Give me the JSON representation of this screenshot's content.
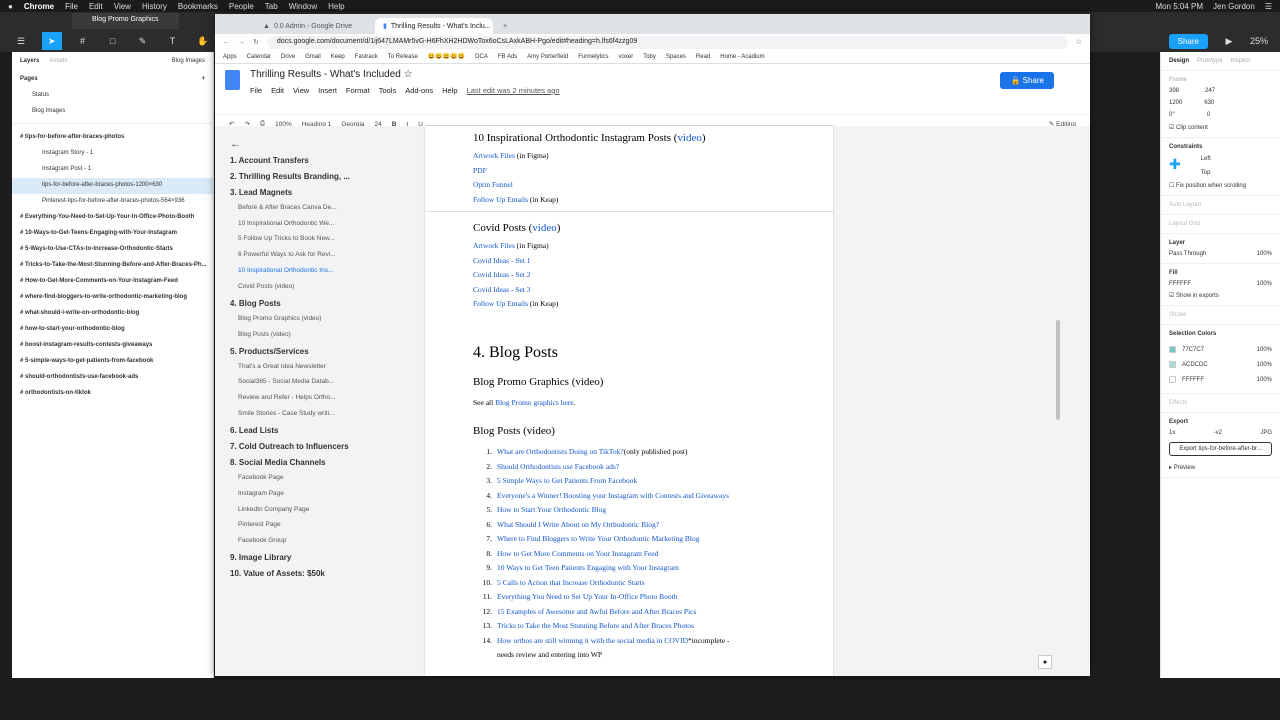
{
  "mac": {
    "app": "Chrome",
    "menus": [
      "File",
      "Edit",
      "View",
      "History",
      "Bookmarks",
      "People",
      "Tab",
      "Window",
      "Help"
    ],
    "clock": "Mon 5:04 PM",
    "user": "Jen Gordon"
  },
  "figma": {
    "file_tab": "Blog Promo Graphics",
    "share": "Share",
    "zoom": "25%",
    "layers_tab": "Layers",
    "assets_tab": "Assets",
    "page_selector": "Blog Images",
    "pages_label": "Pages",
    "pages": [
      "Status",
      "Blog Images"
    ],
    "layers": [
      "tips-for-before-after-braces-photos",
      "Instagram Story - 1",
      "Instagram Post - 1",
      "tips-for-before-after-braces-photos-1200×630",
      "Pinterest-tips-for-before-after-braces-photos-564×936",
      "Everything-You-Need-to-Set-Up-Your-In-Office-Photo-Booth",
      "10-Ways-to-Get-Teens-Engaging-with-Your-Instagram",
      "5-Ways-to-Use-CTAs-to-Increase-Orthodontic-Starts",
      "Tricks-to-Take-the-Most-Stunning-Before-and-After-Braces-Ph...",
      "How-to-Get-More-Comments-on-Your-Instagram-Feed",
      "where-find-bloggers-to-write-orthodontic-marketing-blog",
      "what-should-i-write-on-orthodontic-blog",
      "how-to-start-your-orthodontic-blog",
      "boost-instagram-results-contests-giveaways",
      "5-simple-ways-to-get-patients-from-facebook",
      "should-orthodontists-use-facebook-ads",
      "orthodontists-on-tiktok"
    ],
    "right": {
      "tabs": [
        "Design",
        "Prototype",
        "Inspect"
      ],
      "frame": "Frame",
      "x": "398",
      "y": "247",
      "w": "1200",
      "h": "630",
      "rot": "0°",
      "radius": "0",
      "clip": "Clip content",
      "constraints": "Constraints",
      "h_con": "Left",
      "v_con": "Top",
      "fix": "Fix position when scrolling",
      "auto_layout": "Auto Layout",
      "layout_grid": "Layout Grid",
      "layer": "Layer",
      "blend": "Pass Through",
      "opacity": "100%",
      "fill": "Fill",
      "fill_hex": "FFFFFF",
      "fill_op": "100%",
      "show_exports": "Show in exports",
      "stroke": "Stroke",
      "sel_colors": "Selection Colors",
      "colors": [
        {
          "hex": "77C7C7",
          "op": "100%",
          "sw": "#77c7c7"
        },
        {
          "hex": "ACDCDC",
          "op": "100%",
          "sw": "#acdcdc"
        },
        {
          "hex": "FFFFFF",
          "op": "100%",
          "sw": "#ffffff"
        }
      ],
      "effects": "Effects",
      "export": "Export",
      "scale": "1x",
      "suffix": "-v2",
      "fmt": "JPG",
      "export_btn": "Export tips-for-before-after-br...",
      "preview": "Preview"
    }
  },
  "chrome": {
    "tabs": [
      "0.0 Admin - Google Drive",
      "Thrilling Results - What's Inclu..."
    ],
    "url": "docs.google.com/document/d/1ij647LMAMr5vG-H6FhXH2HDWoTox6oCsLAxkABH-Pgo/edit#heading=h.lfs6f4zzg09",
    "bookmarks": [
      "Apps",
      "Calendar",
      "Drive",
      "Gmail",
      "Keep",
      "Fastrack",
      "To Release",
      "😀😀😀😀😀",
      "DCA",
      "FB Ads",
      "Amy Porterfield",
      "Funnelytics",
      "voxer",
      "Toby",
      "Spaces",
      "Read",
      "Home - Acadium"
    ]
  },
  "docs": {
    "title": "Thrilling Results - What's Included",
    "menus": [
      "File",
      "Edit",
      "View",
      "Insert",
      "Format",
      "Tools",
      "Add-ons",
      "Help"
    ],
    "last_edit": "Last edit was 2 minutes ago",
    "share": "Share",
    "toolbar": {
      "zoom": "100%",
      "style": "Heading 1",
      "font": "Georgia",
      "size": "24",
      "mode": "Editing"
    }
  },
  "outline": [
    {
      "t": "1. Account Transfers",
      "h": true
    },
    {
      "t": "2. Thrilling Results Branding, ...",
      "h": true
    },
    {
      "t": "3. Lead Magnets",
      "h": true
    },
    {
      "t": "Before & After Braces Canva De..."
    },
    {
      "t": "10 Inspirational Orthodontic We..."
    },
    {
      "t": "5 Follow Up Tricks to Book New..."
    },
    {
      "t": "6 Powerful Ways to Ask for Revi..."
    },
    {
      "t": "10 Inspirational Orthodontic Ins...",
      "cur": true
    },
    {
      "t": "Covid Posts (video)"
    },
    {
      "t": "4. Blog Posts",
      "h": true
    },
    {
      "t": "Blog Promo Graphics (video)"
    },
    {
      "t": "Blog Posts (video)"
    },
    {
      "t": "5. Products/Services",
      "h": true
    },
    {
      "t": "That's a Great Idea Newsletter"
    },
    {
      "t": "Social365 - Social Media Datab..."
    },
    {
      "t": "Review and Refer - Helps Ortho..."
    },
    {
      "t": "Smile Stories - Case Study writi..."
    },
    {
      "t": "6. Lead Lists",
      "h": true
    },
    {
      "t": "7. Cold Outreach to Influencers",
      "h": true
    },
    {
      "t": "8. Social Media Channels",
      "h": true
    },
    {
      "t": "Facebook Page"
    },
    {
      "t": "Instagram Page"
    },
    {
      "t": "LinkedIn Company Page"
    },
    {
      "t": "Pinterest Page"
    },
    {
      "t": "Facebook Group"
    },
    {
      "t": "9. Image Library",
      "h": true
    },
    {
      "t": "10. Value of Assets: $50k",
      "h": true
    }
  ],
  "content": {
    "insta_head": "10 Inspirational Orthodontic Instagram Posts (",
    "video": "video",
    ")": ")",
    "insta_links": [
      {
        "link": "Artwork Files",
        "rest": " (in Figma)"
      },
      {
        "link": "PDF",
        "rest": ""
      },
      {
        "link": "Optin Funnel",
        "rest": ""
      },
      {
        "link": "Follow Up Emails",
        "rest": " (in Keap)"
      }
    ],
    "covid_head": "Covid Posts (",
    "covid_links": [
      {
        "link": "Artwork Files",
        "rest": " (in Figma)"
      },
      {
        "link": "Covid Ideas - Set 1",
        "rest": ""
      },
      {
        "link": "Covid Ideas - Set 2",
        "rest": ""
      },
      {
        "link": "Covid Ideas - Set 3",
        "rest": ""
      },
      {
        "link": "Follow Up Emails",
        "rest": " (in Keap)"
      }
    ],
    "h1": "4. Blog Posts",
    "promo_head": "Blog Promo Graphics (video)",
    "see_all": "See all ",
    "see_link": "Blog Promo graphics here",
    "dot": ".",
    "posts_head": "Blog Posts (video)",
    "posts": [
      {
        "n": "1.",
        "link": "What are Orthodontists Doing on TikTok?",
        "rest": " (only published post)"
      },
      {
        "n": "2.",
        "link": "Should Orthodontists use Facebook ads?",
        "rest": ""
      },
      {
        "n": "3.",
        "link": "5 Simple Ways to Get Patients From Facebook",
        "rest": ""
      },
      {
        "n": "4.",
        "link": "Everyone's a Winner! Boosting your Instagram with Contests and Giveaways",
        "rest": ""
      },
      {
        "n": "5.",
        "link": "How to Start Your Orthodontic Blog",
        "rest": ""
      },
      {
        "n": "6.",
        "link": "What Should I Write About on My Orthodontic Blog?",
        "rest": ""
      },
      {
        "n": "7.",
        "link": "Where to Find Bloggers to Write Your Orthodontic Marketing Blog",
        "rest": ""
      },
      {
        "n": "8.",
        "link": "How to Get More Comments on Your Instagram Feed",
        "rest": ""
      },
      {
        "n": "9.",
        "link": "10 Ways to Get Teen Patients Engaging with Your Instagram",
        "rest": ""
      },
      {
        "n": "10.",
        "link": "5 Calls to Action that Increase Orthodontic Starts",
        "rest": ""
      },
      {
        "n": "11.",
        "link": "Everything You Need to Set Up Your In-Office Photo Booth",
        "rest": ""
      },
      {
        "n": "12.",
        "link": "15 Examples of Awesome and Awful Before and After Braces Pics",
        "rest": ""
      },
      {
        "n": "13.",
        "link": "Tricks to Take the Most Stunning Before and After Braces Photos",
        "rest": ""
      },
      {
        "n": "14.",
        "link": "How orthos are still winning it with the social media in COVID",
        "rest": " *incomplete -"
      }
    ],
    "last_line": "needs review and entering into WP"
  }
}
